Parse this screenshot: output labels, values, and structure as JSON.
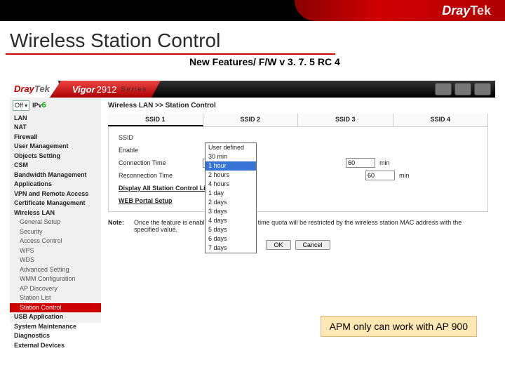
{
  "brand": {
    "name": "Dray",
    "suffix": "Tek"
  },
  "title": "Wireless Station Control",
  "subtitle": "New Features/ F/W v 3. 7. 5 RC 4",
  "header": {
    "logo_text": "Dray",
    "logo_suffix": "Tek",
    "model_prefix": "Vigor",
    "model_num": "2912",
    "model_series": "Series"
  },
  "sidebar": {
    "select_value": "Off",
    "ipv6_label": "IPv",
    "ipv6_six": "6",
    "groups": [
      "LAN",
      "NAT",
      "Firewall",
      "User Management",
      "Objects Setting",
      "CSM",
      "Bandwidth Management",
      "Applications",
      "VPN and Remote Access",
      "Certificate Management",
      "Wireless LAN"
    ],
    "wlan_sub": [
      "General Setup",
      "Security",
      "Access Control",
      "WPS",
      "WDS",
      "Advanced Setting",
      "WMM Configuration",
      "AP Discovery",
      "Station List",
      "Station Control"
    ],
    "tail": [
      "USB Application",
      "System Maintenance",
      "Diagnostics",
      "External Devices"
    ]
  },
  "main": {
    "crumb": "Wireless LAN >> Station Control",
    "tabs": [
      "SSID 1",
      "SSID 2",
      "SSID 3",
      "SSID 4"
    ],
    "ssid_label": "SSID",
    "enable_label": "Enable",
    "conn_label": "Connection Time",
    "conn_value": "1 hour",
    "conn_input": "60",
    "conn_unit": "min",
    "reconn_label": "Reconnection Time",
    "reconn_input": "60",
    "reconn_unit": "min",
    "link1": "Display All Station Control List",
    "link2": "WEB Portal Setup",
    "dropdown": [
      "User defined",
      "30 min",
      "1 hour",
      "2 hours",
      "4 hours",
      "1 day",
      "2 days",
      "3 days",
      "4 days",
      "5 days",
      "6 days",
      "7 days"
    ],
    "note_label": "Note:",
    "note_text": "Once the feature is enabled, the connection time quota will be restricted by the wireless station MAC address with the specified value.",
    "ok": "OK",
    "cancel": "Cancel"
  },
  "callout": "APM only can work with AP 900"
}
